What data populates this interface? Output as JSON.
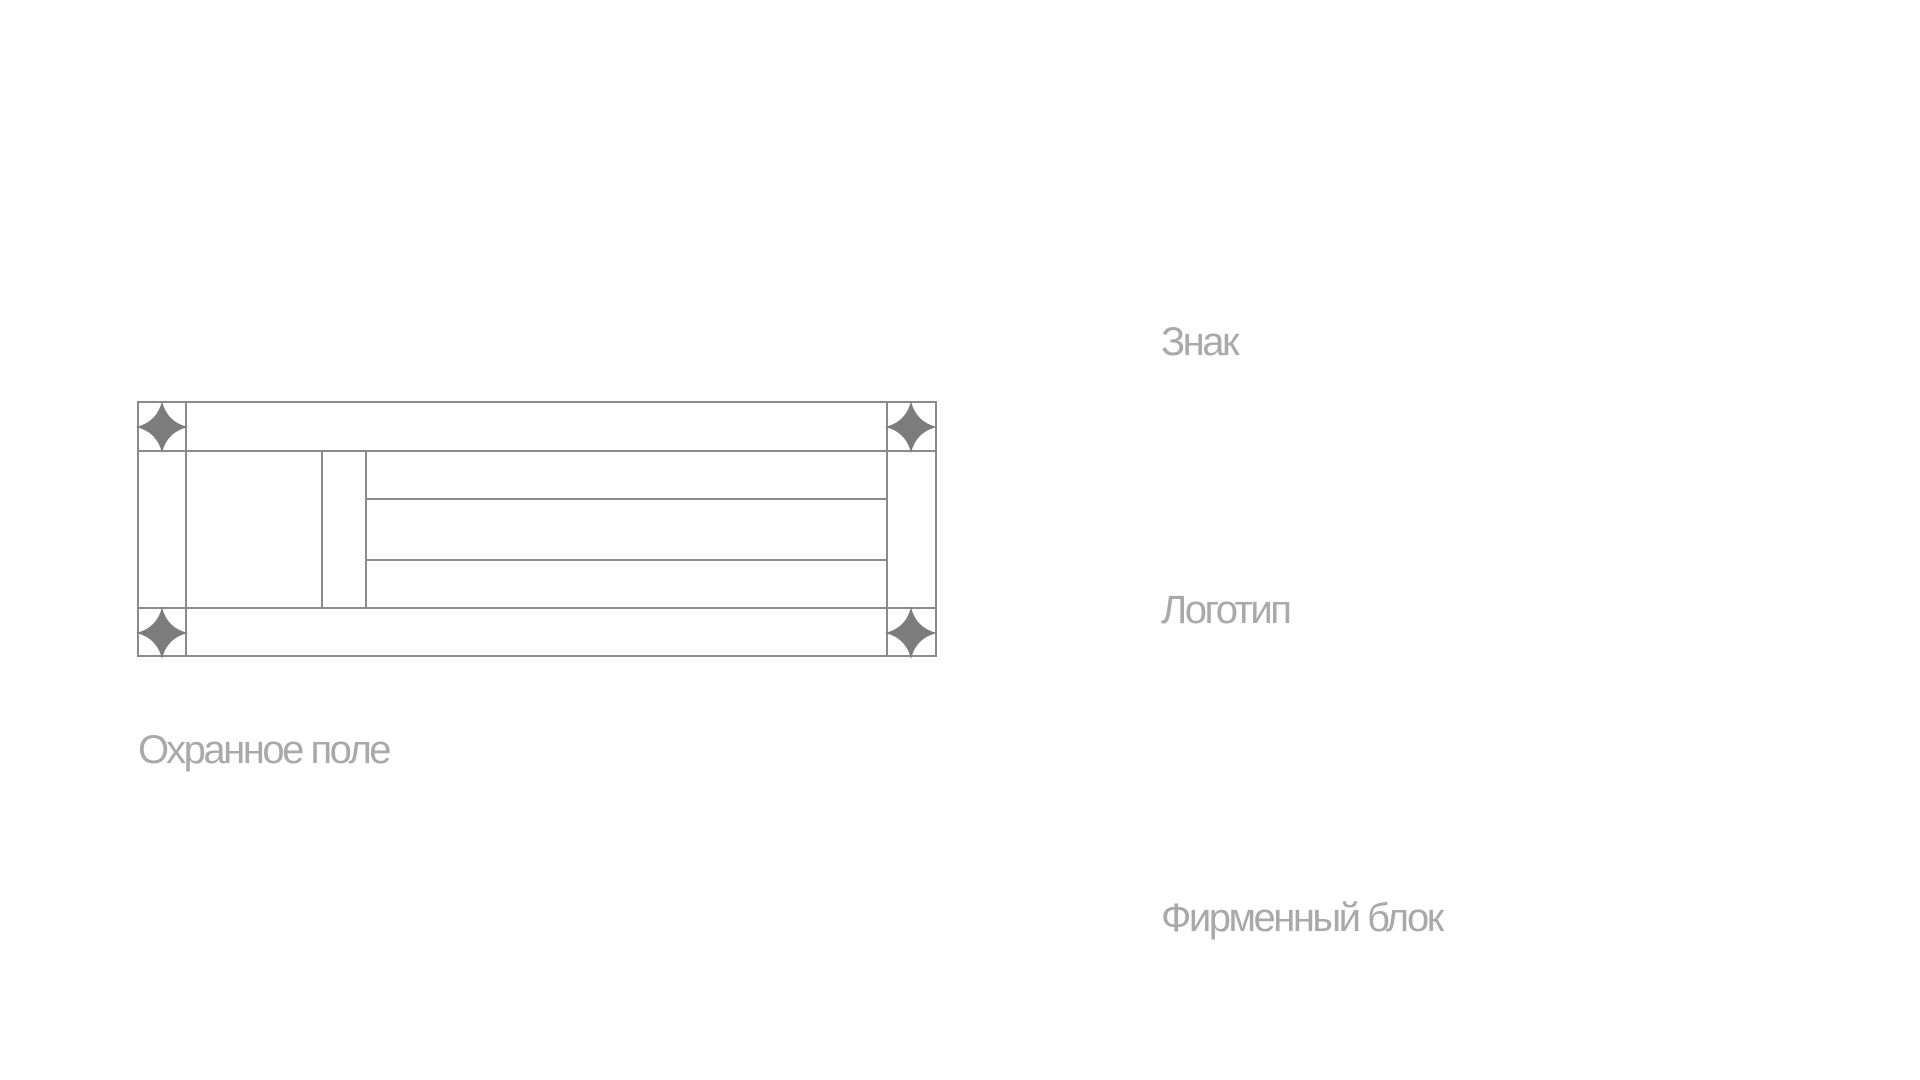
{
  "labels": {
    "znak": "Знак",
    "logotip": "Логотип",
    "firm_block": "Фирменный блок",
    "clear_space": "Охранное поле"
  },
  "icons": {
    "corner_marker": "four-point-star-icon"
  },
  "colors": {
    "line": "#8a8a8a",
    "marker": "#7c7c7c",
    "label": "#a9a9a9",
    "background": "#ffffff"
  }
}
